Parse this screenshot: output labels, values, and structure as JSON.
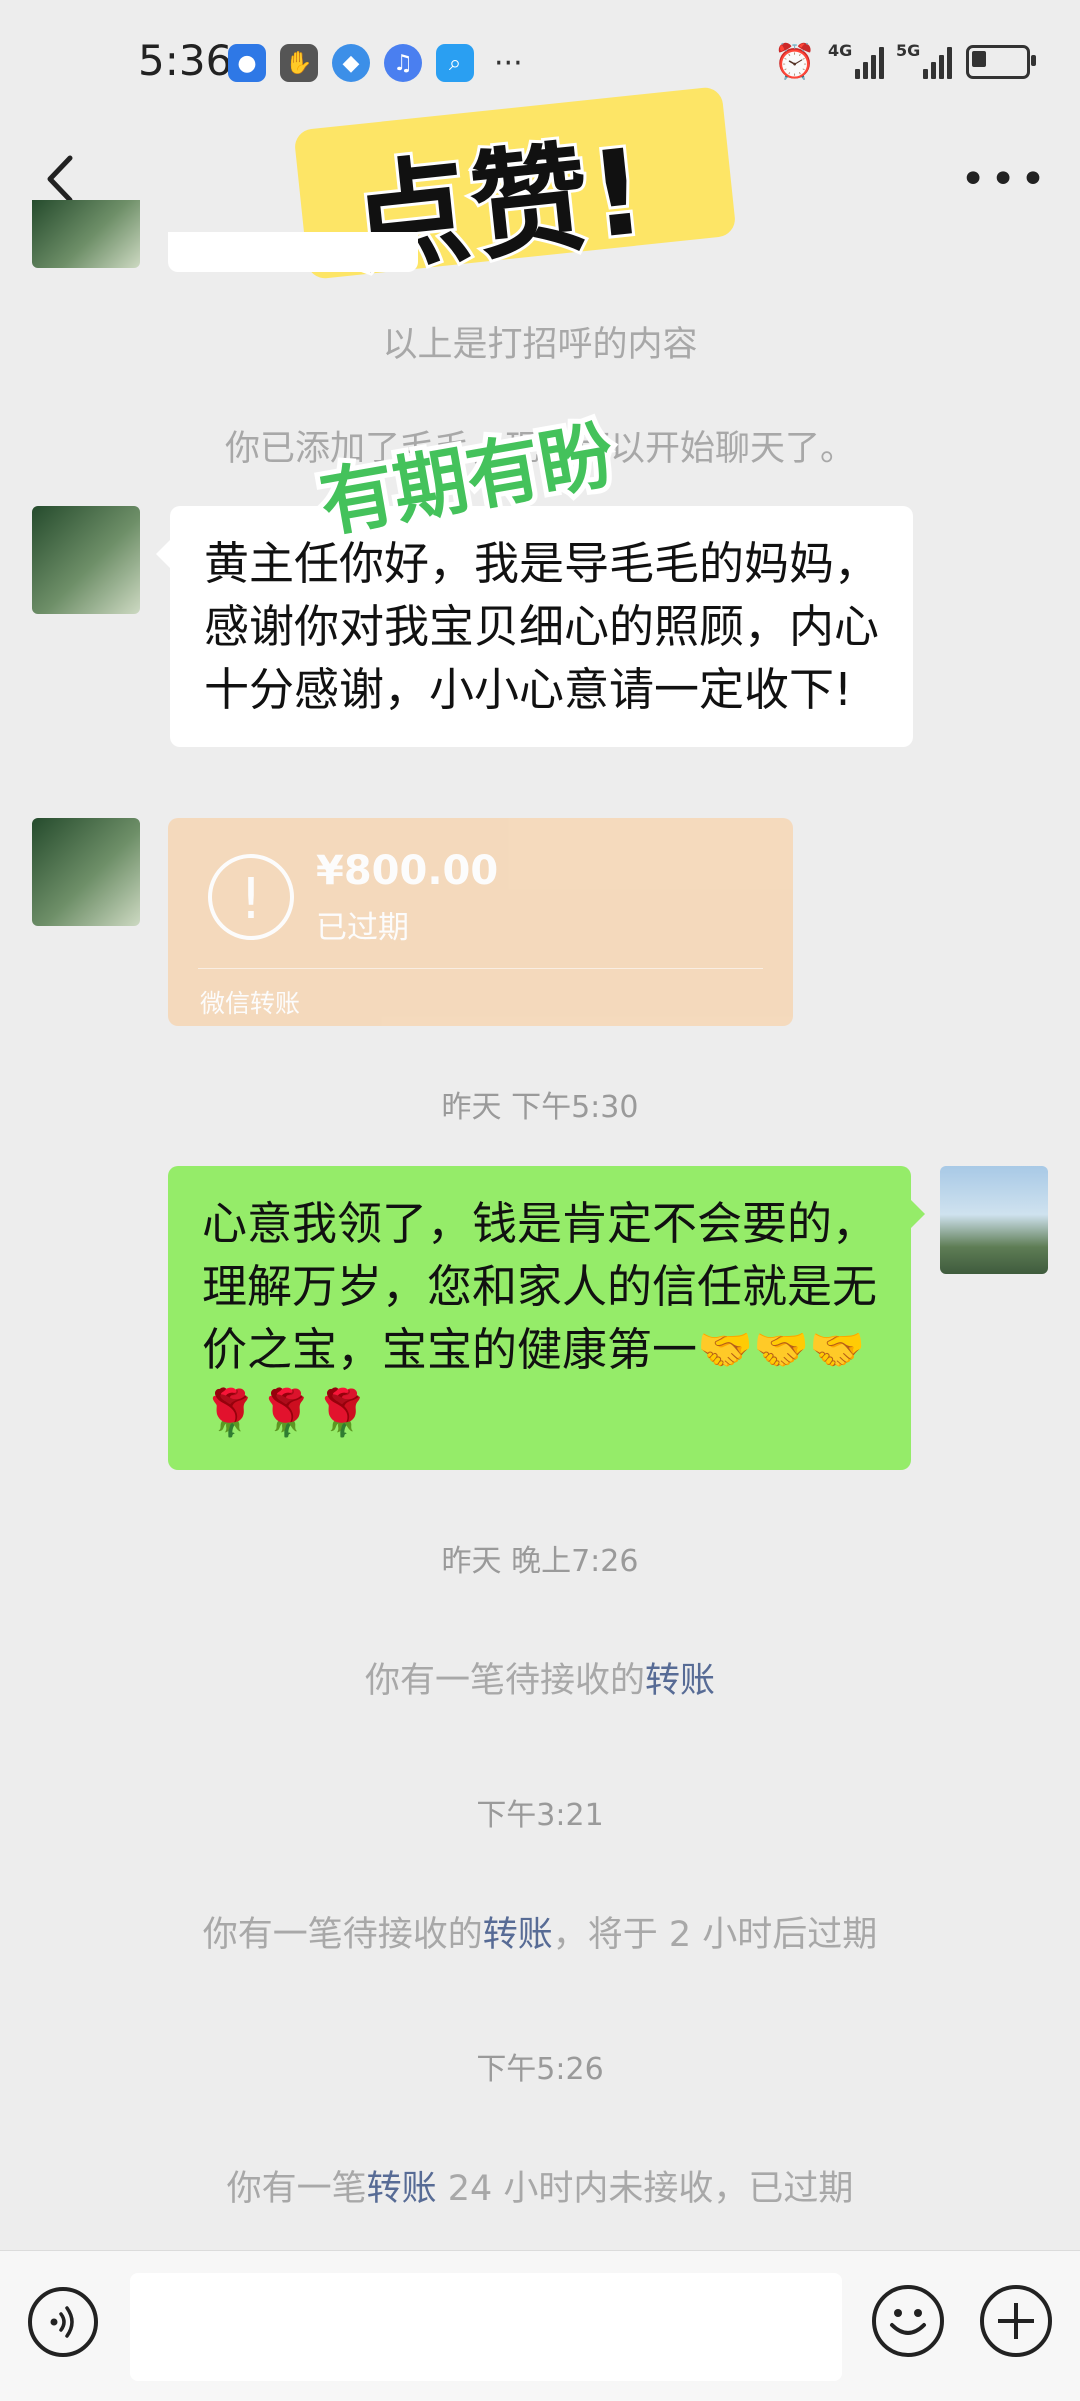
{
  "status_bar": {
    "time": "5:36",
    "overflow_dots": "···",
    "net_1": "4G",
    "net_2": "5G"
  },
  "stickers": {
    "like_text": "点赞!",
    "wish_text": "有期有盼"
  },
  "messages": {
    "sys_greeting": "以上是打招呼的内容",
    "sys_added": "你已添加了毛毛，现在可以开始聊天了。",
    "msg_left_1": "黄主任你好，我是导毛毛的妈妈，感谢你对我宝贝细心的照顾，内心十分感谢，小小心意请一定收下!",
    "transfer": {
      "amount": "¥800.00",
      "status": "已过期",
      "footer": "微信转账"
    },
    "time_1": "昨天 下午5:30",
    "msg_right_1": "心意我领了，钱是肯定不会要的，理解万岁，您和家人的信任就是无价之宝，宝宝的健康第一🤝🤝🤝\n🌹🌹🌹",
    "time_2": "昨天 晚上7:26",
    "sys_transfer_1": {
      "prefix": "你有一笔待接收的",
      "link": "转账",
      "suffix": ""
    },
    "time_3": "下午3:21",
    "sys_transfer_2": {
      "prefix": "你有一笔待接收的",
      "link": "转账",
      "suffix": "，将于 2 小时后过期"
    },
    "time_4": "下午5:26",
    "sys_transfer_3": {
      "prefix": "你有一笔",
      "link": "转账",
      "suffix": " 24 小时内未接收，已过期"
    }
  },
  "input_bar": {
    "placeholder": ""
  }
}
